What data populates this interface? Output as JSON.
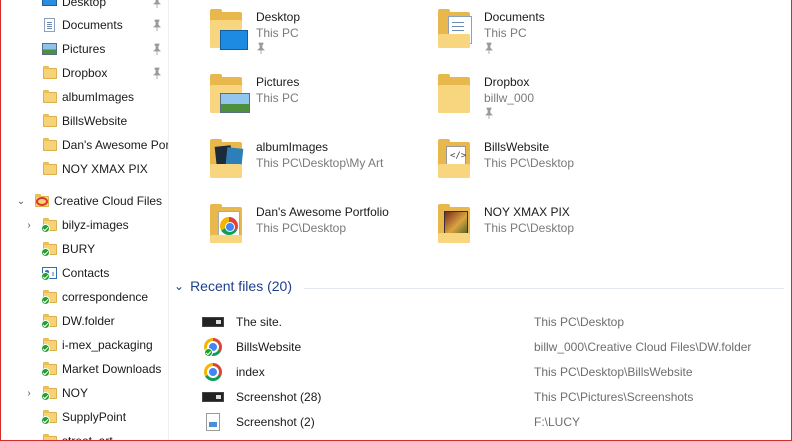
{
  "sidebar": {
    "items": [
      {
        "label": "Desktop",
        "icon": "desktop-icon",
        "pinned": true
      },
      {
        "label": "Documents",
        "icon": "documents-icon",
        "pinned": true
      },
      {
        "label": "Pictures",
        "icon": "pictures-icon",
        "pinned": true
      },
      {
        "label": "Dropbox",
        "icon": "folder-icon",
        "pinned": true
      },
      {
        "label": "albumImages",
        "icon": "folder-icon",
        "pinned": false
      },
      {
        "label": "BillsWebsite",
        "icon": "folder-icon",
        "pinned": false
      },
      {
        "label": "Dan's Awesome Portfolio",
        "icon": "folder-icon",
        "pinned": false
      },
      {
        "label": "NOY XMAX PIX",
        "icon": "folder-icon",
        "pinned": false
      }
    ],
    "cloud": {
      "label": "Creative Cloud Files",
      "icon": "creative-cloud-icon",
      "expanded": true,
      "children": [
        {
          "label": "bilyz-images",
          "expandable": true
        },
        {
          "label": "BURY",
          "expandable": false
        },
        {
          "label": "Contacts",
          "expandable": false,
          "icon": "contacts-icon"
        },
        {
          "label": "correspondence",
          "expandable": false
        },
        {
          "label": "DW.folder",
          "expandable": false
        },
        {
          "label": "i-mex_packaging",
          "expandable": false
        },
        {
          "label": "Market Downloads",
          "expandable": false
        },
        {
          "label": "NOY",
          "expandable": true
        },
        {
          "label": "SupplyPoint",
          "expandable": false
        },
        {
          "label": "street_art",
          "expandable": false
        }
      ]
    }
  },
  "quick_access": [
    {
      "name": "Desktop",
      "location": "This PC",
      "pinned": true,
      "icon": "desktop-folder-icon"
    },
    {
      "name": "Documents",
      "location": "This PC",
      "pinned": true,
      "icon": "documents-folder-icon"
    },
    {
      "name": "Pictures",
      "location": "This PC",
      "pinned": false,
      "icon": "pictures-folder-icon"
    },
    {
      "name": "Dropbox",
      "location": "billw_000",
      "pinned": true,
      "icon": "folder-icon"
    },
    {
      "name": "albumImages",
      "location": "This PC\\Desktop\\My Art",
      "pinned": false,
      "icon": "album-folder-icon"
    },
    {
      "name": "BillsWebsite",
      "location": "This PC\\Desktop",
      "pinned": false,
      "icon": "website-folder-icon"
    },
    {
      "name": "Dan's Awesome Portfolio",
      "location": "This PC\\Desktop",
      "pinned": false,
      "icon": "chrome-folder-icon"
    },
    {
      "name": "NOY XMAX PIX",
      "location": "This PC\\Desktop",
      "pinned": false,
      "icon": "photo-folder-icon"
    }
  ],
  "recent": {
    "title": "Recent files (20)",
    "files": [
      {
        "name": "The site.",
        "location": "This PC\\Desktop",
        "icon": "screenshot-file-icon"
      },
      {
        "name": "BillsWebsite",
        "location": "billw_000\\Creative Cloud Files\\DW.folder",
        "icon": "chrome-icon"
      },
      {
        "name": "index",
        "location": "This PC\\Desktop\\BillsWebsite",
        "icon": "chrome-icon"
      },
      {
        "name": "Screenshot (28)",
        "location": "This PC\\Pictures\\Screenshots",
        "icon": "screenshot-file-icon"
      },
      {
        "name": "Screenshot (2)",
        "location": "F:\\LUCY",
        "icon": "image-file-icon"
      }
    ]
  }
}
